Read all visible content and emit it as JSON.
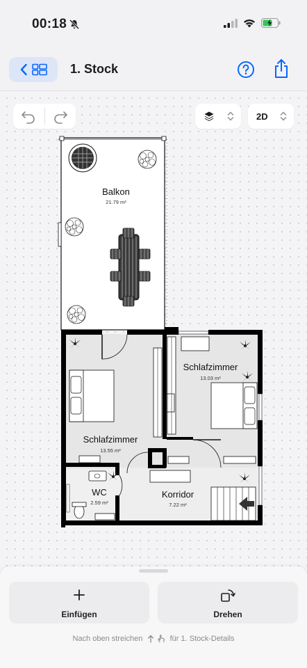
{
  "status": {
    "time": "00:18"
  },
  "header": {
    "title": "1. Stock"
  },
  "toolbar": {
    "view_mode": "2D"
  },
  "rooms": [
    {
      "name": "Balkon",
      "area": "21.79 m²"
    },
    {
      "name": "Schlafzimmer",
      "area": "13.03 m²"
    },
    {
      "name": "Schlafzimmer",
      "area": "13.55 m²"
    },
    {
      "name": "WC",
      "area": "2.59 m²"
    },
    {
      "name": "Korridor",
      "area": "7.22 m²"
    }
  ],
  "sheet": {
    "insert_label": "Einfügen",
    "rotate_label": "Drehen",
    "hint_left": "Nach oben streichen",
    "hint_right": "für 1. Stock-Details"
  },
  "colors": {
    "accent": "#0a66ff",
    "wall": "#000000",
    "floor": "#e6e6e6"
  }
}
